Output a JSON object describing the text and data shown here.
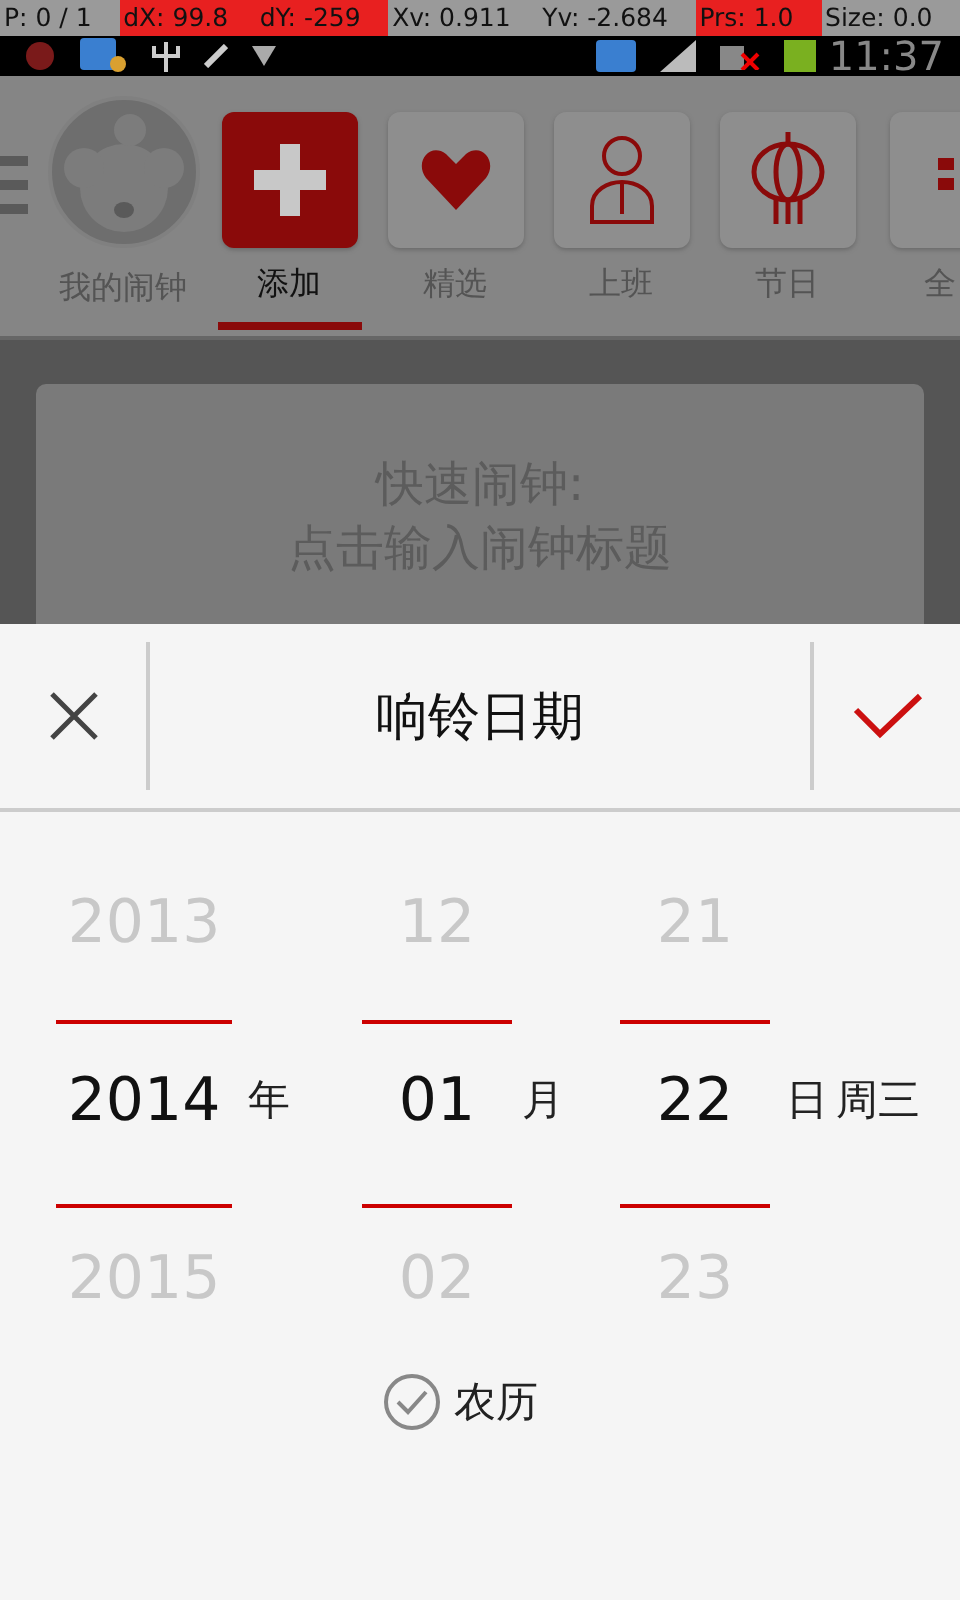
{
  "debug_bar": [
    {
      "text": "P: 0 / 1",
      "highlighted": false
    },
    {
      "text": "dX: 99.8",
      "highlighted": true
    },
    {
      "text": "dY: -259",
      "highlighted": true
    },
    {
      "text": "Xv: 0.911",
      "highlighted": false
    },
    {
      "text": "Yv: -2.684",
      "highlighted": false
    },
    {
      "text": "Prs: 1.0",
      "highlighted": true
    },
    {
      "text": "Size: 0.0",
      "highlighted": false
    }
  ],
  "status_bar": {
    "time": "11:37"
  },
  "tabs": [
    {
      "label": "我的闹钟",
      "kind": "avatar",
      "selected": false
    },
    {
      "label": "添加",
      "kind": "add",
      "selected": true
    },
    {
      "label": "精选",
      "kind": "heart",
      "selected": false
    },
    {
      "label": "上班",
      "kind": "worker",
      "selected": false
    },
    {
      "label": "节日",
      "kind": "lantern",
      "selected": false
    },
    {
      "label": "全",
      "kind": "grid",
      "selected": false
    }
  ],
  "card": {
    "lines": [
      "快速闹钟:",
      "点击输入闹钟标题"
    ]
  },
  "dialog": {
    "title": "响铃日期",
    "columns": [
      {
        "above": "2013",
        "value": "2014",
        "unit": "年",
        "below": "2015"
      },
      {
        "above": "12",
        "value": "01",
        "unit": "月",
        "below": "02"
      },
      {
        "above": "21",
        "value": "22",
        "unit": "日",
        "below": "23"
      }
    ],
    "weekday": "周三",
    "lunar": {
      "label": "农历",
      "checked": true
    }
  }
}
